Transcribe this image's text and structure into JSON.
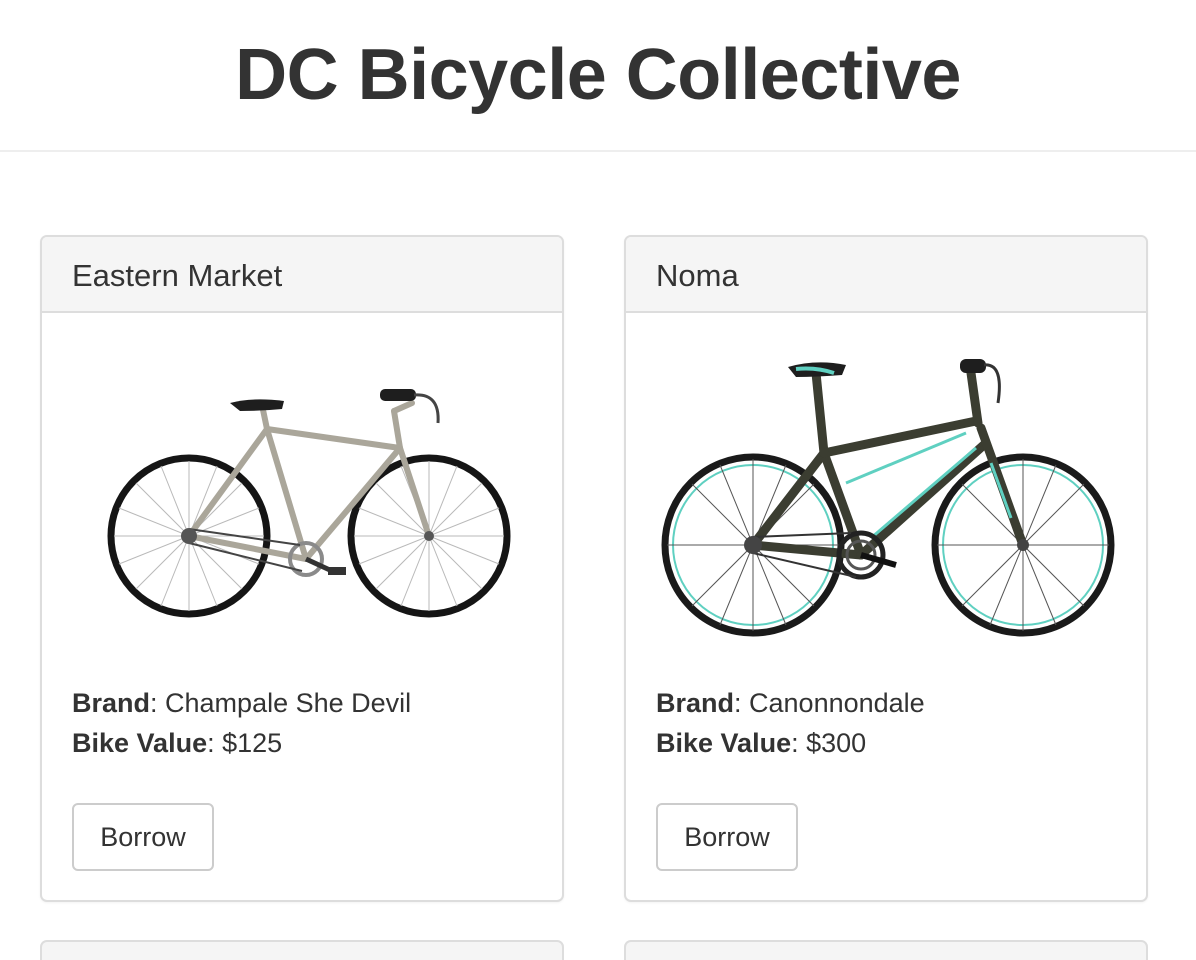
{
  "site": {
    "title": "DC Bicycle Collective"
  },
  "bikes": [
    {
      "location": "Eastern Market",
      "image_icon": "city-bike-image",
      "brand_label": "Brand",
      "brand": "Champale She Devil",
      "value_label": "Bike Value",
      "value": "$125",
      "borrow_label": "Borrow",
      "frame_color": "#b8b4a8"
    },
    {
      "location": "Noma",
      "image_icon": "hybrid-bike-image",
      "brand_label": "Brand",
      "brand": "Canonnondale",
      "value_label": "Bike Value",
      "value": "$300",
      "borrow_label": "Borrow",
      "frame_color": "#3b3d31",
      "accent_color": "#5fd0c1"
    }
  ],
  "colors": {
    "card_border": "#dddddd",
    "card_header_bg": "#f5f5f5",
    "text": "#333333"
  }
}
